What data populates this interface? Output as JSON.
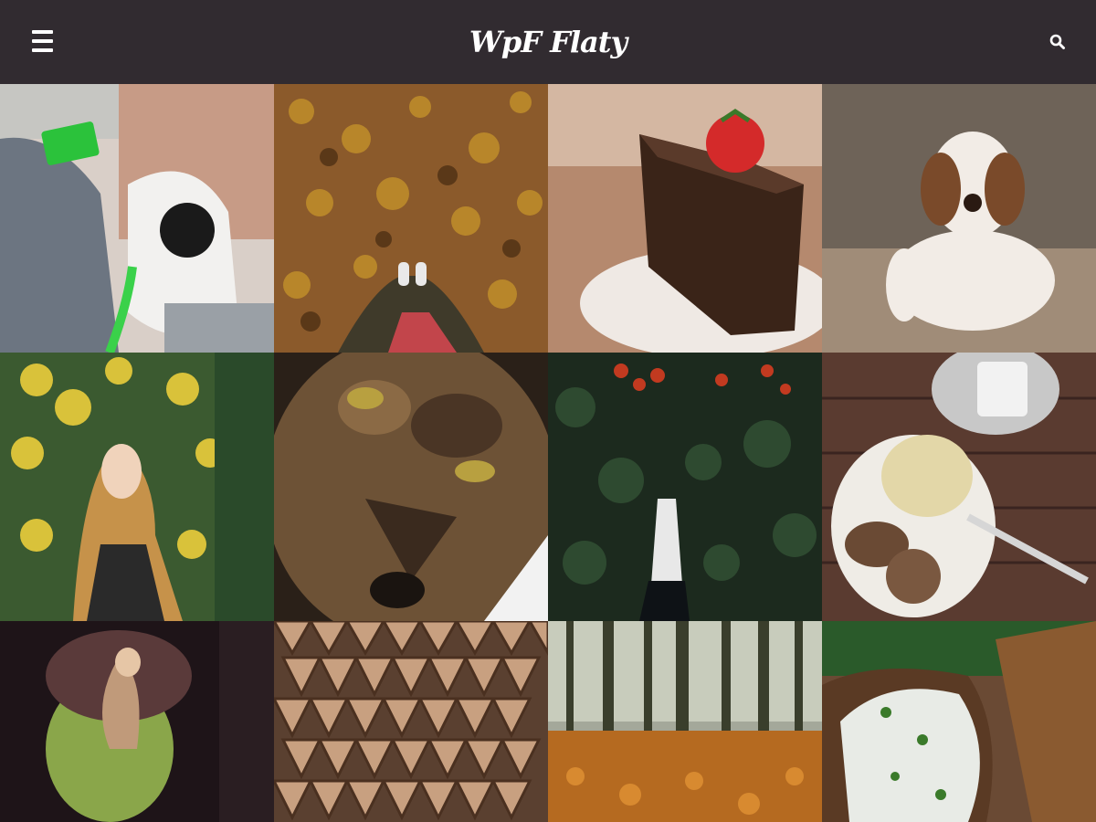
{
  "header": {
    "logo_text": "WpF Flaty",
    "menu_icon": "hamburger-menu-icon",
    "search_icon": "search-icon",
    "background_color": "#312b30"
  },
  "gallery": {
    "tiles": [
      {
        "subject": "headphones-phone",
        "link": "",
        "palette": [
          "#6e7a86",
          "#d8c1b4"
        ]
      },
      {
        "subject": "autumn-leaves-feet",
        "link": "",
        "palette": [
          "#8a5a2a",
          "#b8862a"
        ]
      },
      {
        "subject": "chocolate-cake",
        "link": "",
        "palette": [
          "#b5896e",
          "#3a241a"
        ]
      },
      {
        "subject": "puppy",
        "link": "",
        "palette": [
          "#8d7e72",
          "#f2ece6"
        ]
      },
      {
        "subject": "girl-autumn",
        "link": "",
        "palette": [
          "#3b5a30",
          "#d9c23a"
        ]
      },
      {
        "subject": "cat-closeup",
        "link": "",
        "palette": [
          "#2a2018",
          "#8b6a45"
        ]
      },
      {
        "subject": "ivy-berries",
        "link": "",
        "palette": [
          "#1c2a1e",
          "#c23a20"
        ]
      },
      {
        "subject": "plate-food-table",
        "link": "",
        "palette": [
          "#5a3b30",
          "#efece6"
        ]
      },
      {
        "subject": "person-lightbeam",
        "link": "",
        "palette": [
          "#1e1418",
          "#8aa64a"
        ]
      },
      {
        "subject": "stacked-firewood",
        "link": "",
        "palette": [
          "#7a5a44",
          "#c8a080"
        ]
      },
      {
        "subject": "autumn-forest",
        "link": "",
        "palette": [
          "#3a3e2c",
          "#b56a20"
        ]
      },
      {
        "subject": "bread-cheese",
        "link": "",
        "palette": [
          "#6a4a34",
          "#e8ebe6"
        ]
      }
    ]
  }
}
